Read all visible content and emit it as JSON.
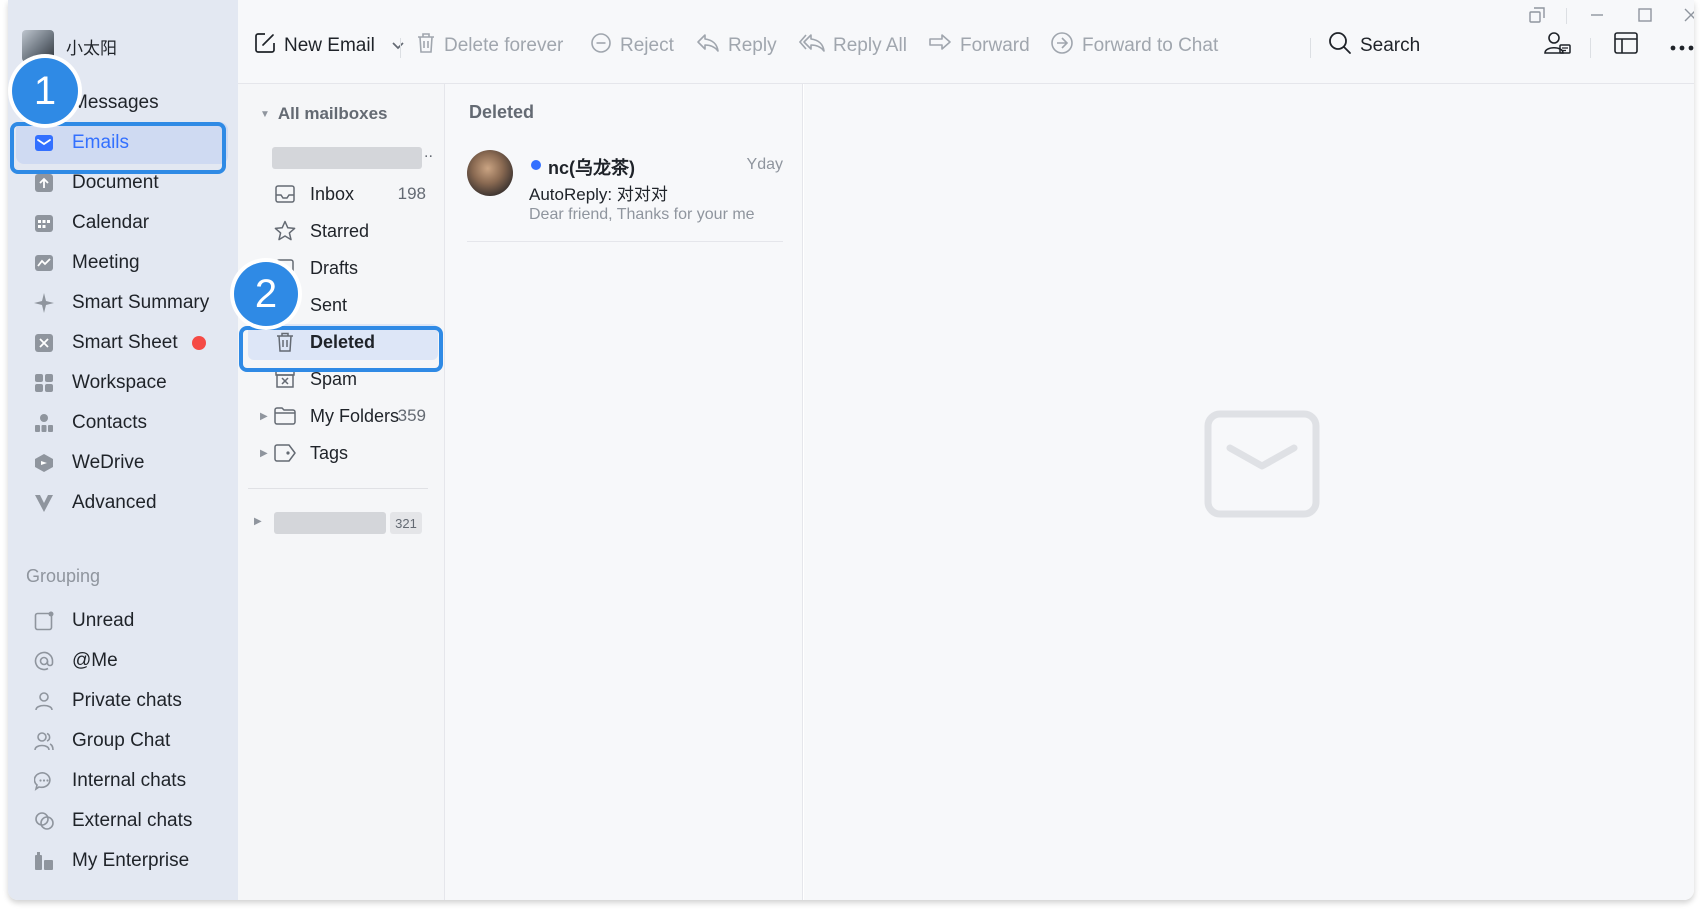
{
  "profile": {
    "name": "小太阳"
  },
  "sidebar": {
    "items": [
      {
        "label": "Messages",
        "icon": "chat-icon"
      },
      {
        "label": "Emails",
        "icon": "mail-icon"
      },
      {
        "label": "Document",
        "icon": "document-icon"
      },
      {
        "label": "Calendar",
        "icon": "calendar-icon"
      },
      {
        "label": "Meeting",
        "icon": "meeting-icon"
      },
      {
        "label": "Smart Summary",
        "icon": "sparkle-icon"
      },
      {
        "label": "Smart Sheet",
        "icon": "sheet-icon"
      },
      {
        "label": "Workspace",
        "icon": "grid-icon"
      },
      {
        "label": "Contacts",
        "icon": "contacts-icon"
      },
      {
        "label": "WeDrive",
        "icon": "drive-icon"
      },
      {
        "label": "Advanced",
        "icon": "advanced-icon"
      }
    ],
    "group_header": "Grouping",
    "groups": [
      {
        "label": "Unread",
        "icon": "unread-icon"
      },
      {
        "label": "@Me",
        "icon": "at-icon"
      },
      {
        "label": "Private chats",
        "icon": "person-icon"
      },
      {
        "label": "Group Chat",
        "icon": "people-icon"
      },
      {
        "label": "Internal chats",
        "icon": "bubble-icon"
      },
      {
        "label": "External chats",
        "icon": "bubbles-icon"
      },
      {
        "label": "My Enterprise",
        "icon": "building-icon"
      }
    ]
  },
  "toolbar": {
    "new_email": "New Email",
    "delete_forever": "Delete forever",
    "reject": "Reject",
    "reply": "Reply",
    "reply_all": "Reply All",
    "forward": "Forward",
    "forward_to_chat": "Forward to Chat",
    "search": "Search"
  },
  "mailboxes": {
    "header": "All mailboxes",
    "folders": [
      {
        "label": "Inbox",
        "count": "198",
        "icon": "inbox-icon"
      },
      {
        "label": "Starred",
        "count": "",
        "icon": "star-icon"
      },
      {
        "label": "Drafts",
        "count": "",
        "icon": "drafts-icon"
      },
      {
        "label": "Sent",
        "count": "",
        "icon": "sent-icon"
      },
      {
        "label": "Deleted",
        "count": "",
        "icon": "trash-icon"
      },
      {
        "label": "Spam",
        "count": "",
        "icon": "spam-icon"
      },
      {
        "label": "My Folders",
        "count": "359",
        "icon": "folder-icon"
      },
      {
        "label": "Tags",
        "count": "",
        "icon": "tag-icon"
      }
    ],
    "second_account_count": "321"
  },
  "list": {
    "title": "Deleted",
    "items": [
      {
        "sender": "nc(乌龙茶)",
        "time": "Yday",
        "subject": "AutoReply: 对对对",
        "preview": "Dear friend, Thanks for your me"
      }
    ]
  },
  "callouts": {
    "one": "1",
    "two": "2"
  },
  "colors": {
    "accent": "#3370ff",
    "callout": "#2f8ae5",
    "badge": "#f54a45"
  }
}
